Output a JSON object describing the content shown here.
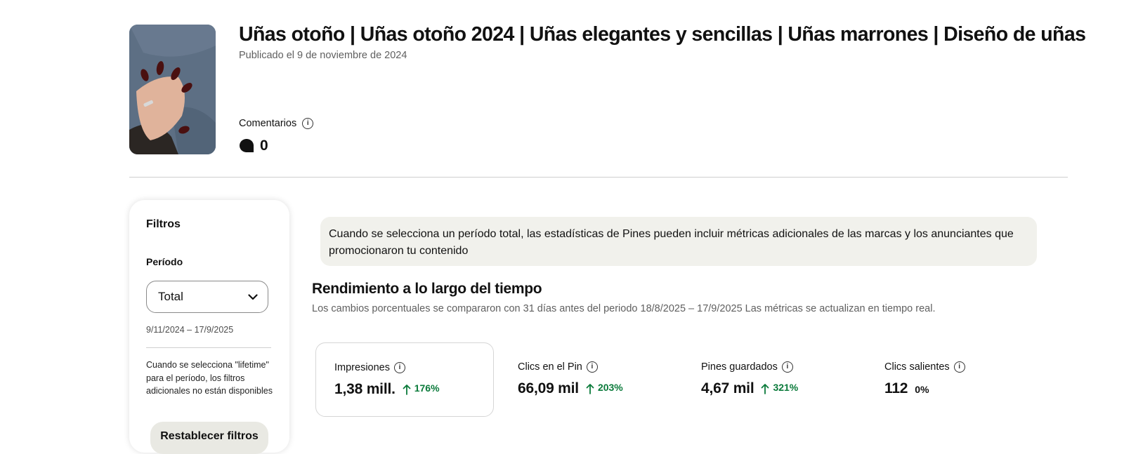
{
  "pin": {
    "title": "Uñas otoño | Uñas otoño 2024 | Uñas elegantes y sencillas | Uñas marrones | Diseño de uñas",
    "published": "Publicado el 9 de noviembre de 2024",
    "comments_label": "Comentarios",
    "comments_count": "0"
  },
  "filters": {
    "title": "Filtros",
    "period_label": "Período",
    "period_value": "Total",
    "date_range": "9/11/2024 – 17/9/2025",
    "lifetime_note": "Cuando se selecciona \"lifetime\" para el período, los filtros adicionales no están disponibles",
    "reset_label": "Restablecer filtros"
  },
  "banner": {
    "text": "Cuando se selecciona un período total, las estadísticas de Pines pueden incluir métricas adicionales de las marcas y los anunciantes que promocionaron tu contenido"
  },
  "performance": {
    "title": "Rendimiento a lo largo del tiempo",
    "subtitle": "Los cambios porcentuales se compararon con 31 días antes del periodo 18/8/2025 – 17/9/2025 Las métricas se actualizan en tiempo real."
  },
  "metrics": [
    {
      "label": "Impresiones",
      "value": "1,38  mill.",
      "change": "176%"
    },
    {
      "label": "Clics en el Pin",
      "value": "66,09  mil",
      "change": "203%"
    },
    {
      "label": "Pines guardados",
      "value": "4,67  mil",
      "change": "321%"
    },
    {
      "label": "Clics salientes",
      "value": "112",
      "change": "0%"
    }
  ],
  "colors": {
    "positive_change": "#0a7a3a",
    "banner_bg": "#f1f1ec",
    "button_bg": "#e9e9e3"
  },
  "icons": {
    "info": "info-icon",
    "comment": "comment-bubble-icon",
    "dropdown": "chevron-down-icon",
    "increase": "arrow-up-icon"
  }
}
